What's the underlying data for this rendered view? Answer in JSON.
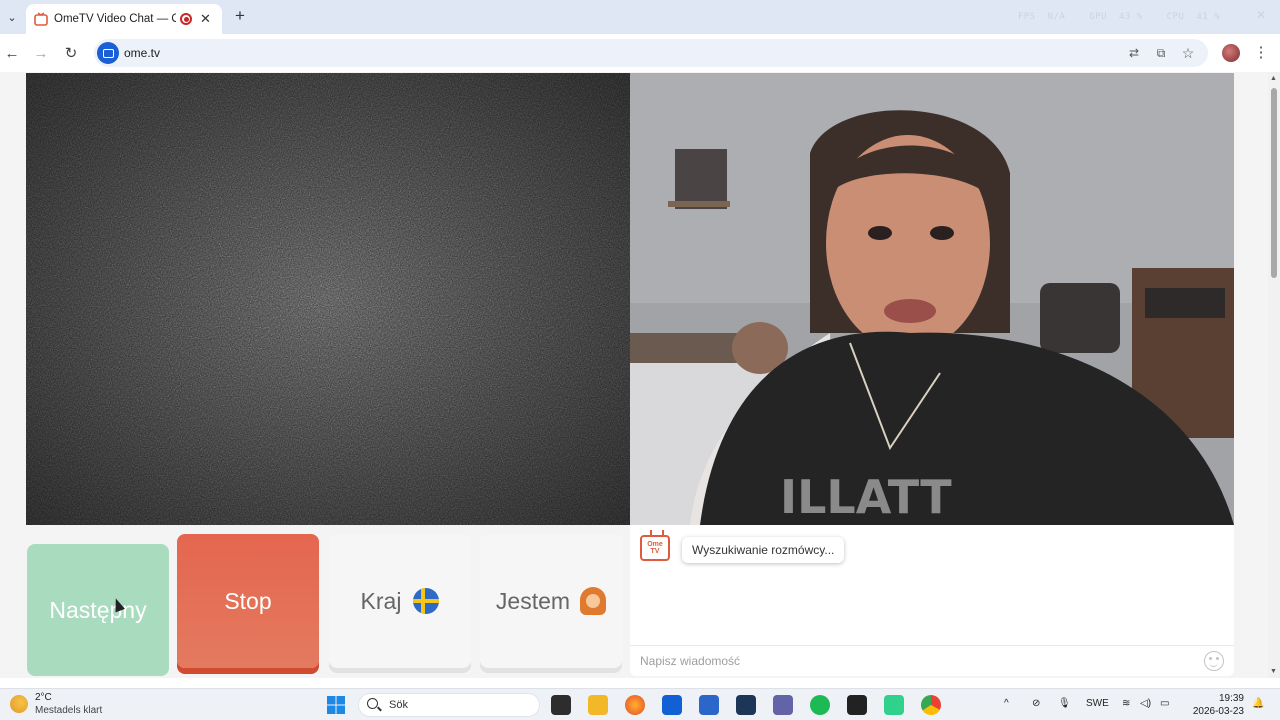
{
  "browser": {
    "tab": {
      "title": "OmeTV Video Chat — Ome",
      "recording": true
    },
    "new_tab_label": "+",
    "url": "ome.tv",
    "perf": {
      "fps_label": "FPS",
      "fps_value": "N/A",
      "gpu_label": "GPU",
      "gpu_value": "43 %",
      "cpu_label": "CPU",
      "cpu_value": "41 %"
    }
  },
  "page": {
    "buttons": {
      "next": "Następny",
      "stop": "Stop",
      "country": "Kraj",
      "gender": "Jestem"
    },
    "chat": {
      "status_message": "Wyszukiwanie rozmówcy...",
      "logo_text": "Ome TV",
      "input_placeholder": "Napisz wiadomość"
    }
  },
  "taskbar": {
    "weather": {
      "temp": "2°C",
      "desc": "Mestadels klart"
    },
    "search_label": "Sök",
    "language": "SWE",
    "time": "19:39",
    "date": "2026-03-23"
  },
  "colors": {
    "stop_button": "#e5664f",
    "next_button": "#a9dcbe",
    "brand": "#e05b3d"
  },
  "icons": [
    "tab-list-icon",
    "back-icon",
    "forward-icon",
    "reload-icon",
    "translate-icon",
    "cast-icon",
    "bookmark-star-icon",
    "profile-avatar",
    "menu-dots-icon",
    "sweden-flag-icon",
    "person-icon",
    "emoji-icon",
    "windows-start-icon",
    "search-icon"
  ]
}
